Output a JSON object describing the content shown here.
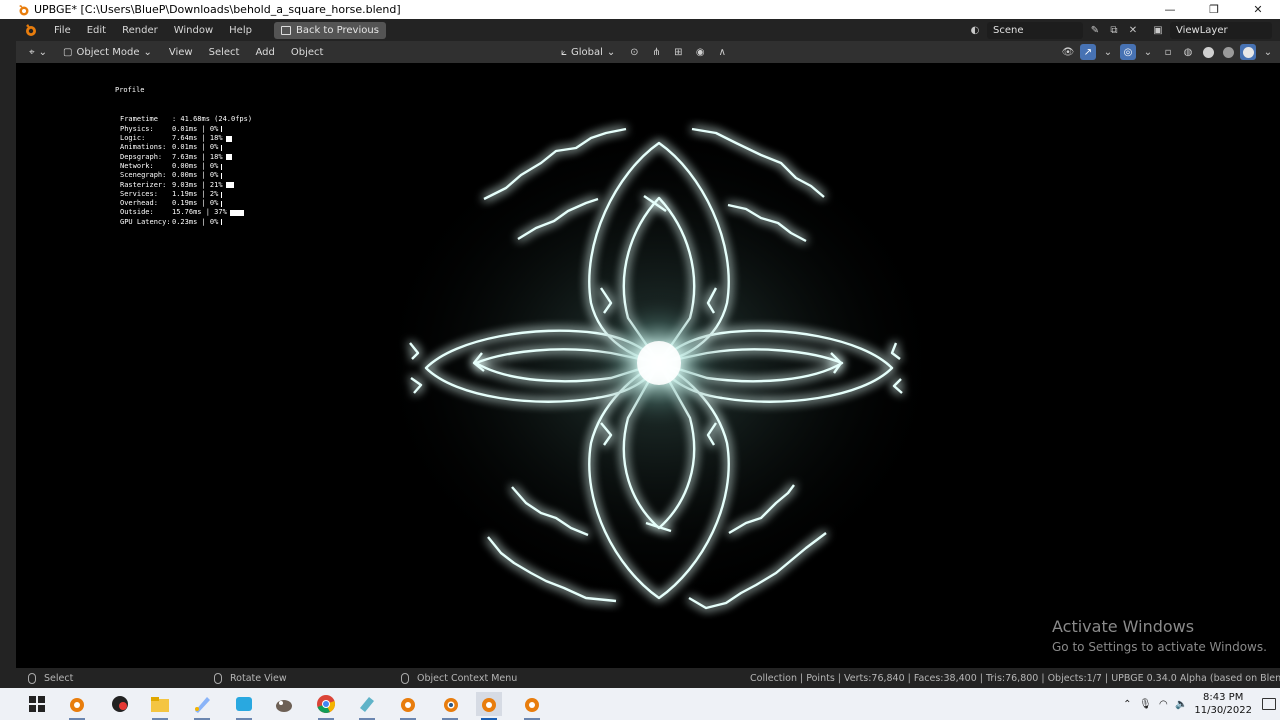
{
  "window": {
    "title": "UPBGE* [C:\\Users\\BlueP\\Downloads\\behold_a_square_horse.blend]"
  },
  "menubar": {
    "items": [
      "File",
      "Edit",
      "Render",
      "Window",
      "Help"
    ],
    "back_button": "Back to Previous",
    "scene": "Scene",
    "view_layer": "ViewLayer"
  },
  "viewport_header": {
    "mode": "Object Mode",
    "menus": [
      "View",
      "Select",
      "Add",
      "Object"
    ],
    "transform_orientation": "Global"
  },
  "profile": {
    "title": "Profile",
    "rows": [
      {
        "name": "Frametime",
        "value": ": 41.68ms (24.0fps)",
        "percent": null
      },
      {
        "name": "Physics:",
        "value": "0.01ms | 0%",
        "percent": 0
      },
      {
        "name": "Logic:",
        "value": "7.64ms | 18%",
        "percent": 18
      },
      {
        "name": "Animations:",
        "value": "0.01ms | 0%",
        "percent": 0
      },
      {
        "name": "Depsgraph:",
        "value": "7.63ms | 18%",
        "percent": 18
      },
      {
        "name": "Network:",
        "value": "0.00ms | 0%",
        "percent": 0
      },
      {
        "name": "Scenegraph:",
        "value": "0.00ms | 0%",
        "percent": 0
      },
      {
        "name": "Rasterizer:",
        "value": "9.03ms | 21%",
        "percent": 21
      },
      {
        "name": "Services:",
        "value": "1.19ms | 2%",
        "percent": 2
      },
      {
        "name": "Overhead:",
        "value": "0.19ms | 0%",
        "percent": 0
      },
      {
        "name": "Outside:",
        "value": "15.76ms | 37%",
        "percent": 37
      },
      {
        "name": "GPU Latency:",
        "value": "0.23ms | 0%",
        "percent": 0
      }
    ]
  },
  "watermark": {
    "line1": "Activate Windows",
    "line2": "Go to Settings to activate Windows."
  },
  "statusbar": {
    "select": "Select",
    "rotate": "Rotate View",
    "context_menu": "Object Context Menu",
    "stats": "Collection | Points | Verts:76,840 | Faces:38,400 | Tris:76,800 | Objects:1/7 | UPBGE 0.34.0 Alpha (based on Blender 3.4.0 Alph"
  },
  "taskbar": {
    "time": "8:43 PM",
    "date": "11/30/2022"
  },
  "colors": {
    "accent": "#4772b3",
    "glow": "#bff5ec"
  }
}
